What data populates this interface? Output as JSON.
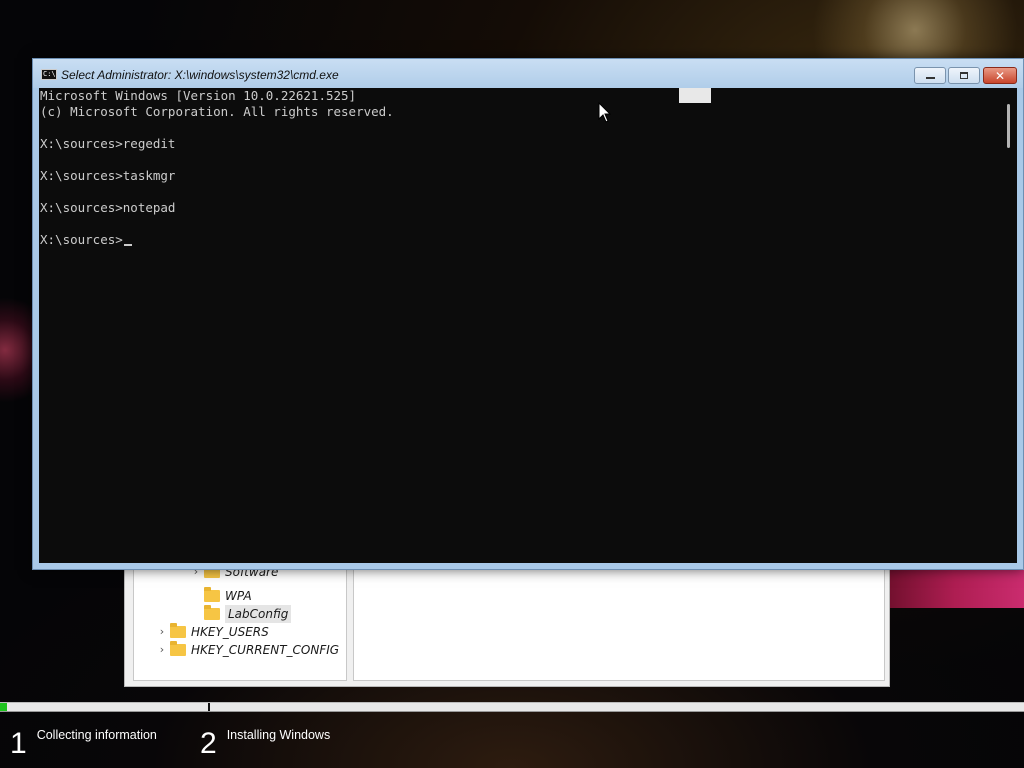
{
  "cmd_window": {
    "title": "Select Administrator: X:\\windows\\system32\\cmd.exe",
    "icon": "cmd-icon",
    "controls": {
      "minimize": "minimize-icon",
      "maximize": "maximize-icon",
      "close_label": "✕"
    },
    "console_lines": [
      "Microsoft Windows [Version 10.0.22621.525]",
      "(c) Microsoft Corporation. All rights reserved.",
      "",
      "X:\\sources>regedit",
      "",
      "X:\\sources>taskmgr",
      "",
      "X:\\sources>notepad",
      "",
      "X:\\sources>"
    ],
    "colors": {
      "background": "#0c0c0c",
      "text": "#cccccc"
    }
  },
  "registry_editor": {
    "tree_items": [
      {
        "label": "Software",
        "level": 2,
        "expander": "›",
        "selected": false
      },
      {
        "label": "WPA",
        "level": 2,
        "expander": "",
        "selected": false
      },
      {
        "label": "LabConfig",
        "level": 2,
        "expander": "",
        "selected": true
      },
      {
        "label": "HKEY_USERS",
        "level": 1,
        "expander": "›",
        "selected": false
      },
      {
        "label": "HKEY_CURRENT_CONFIG",
        "level": 1,
        "expander": "›",
        "selected": false
      }
    ]
  },
  "setup_progress": {
    "progress_fraction": 0.007,
    "accent_color": "#1fc31f",
    "steps": [
      {
        "number": "1",
        "label": "Collecting information"
      },
      {
        "number": "2",
        "label": "Installing Windows"
      }
    ]
  }
}
